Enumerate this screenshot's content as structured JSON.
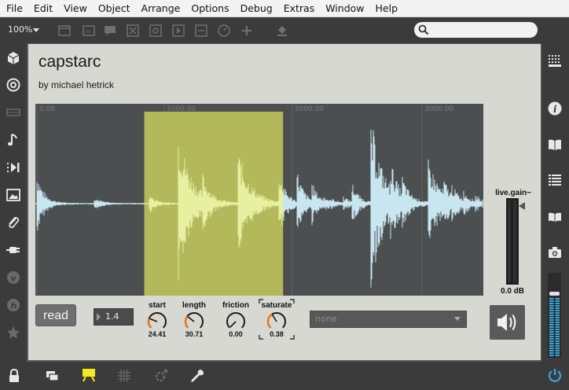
{
  "menubar": {
    "items": [
      "File",
      "Edit",
      "View",
      "Object",
      "Arrange",
      "Options",
      "Debug",
      "Extras",
      "Window",
      "Help"
    ]
  },
  "toolbar": {
    "zoom": "100%",
    "icons": [
      "presentation-icon",
      "comment-box-icon",
      "speech-bubble-icon",
      "close-box-icon",
      "object-icon",
      "play-box-icon",
      "minus-box-icon",
      "gauge-icon",
      "add-icon",
      "paint-bucket-icon"
    ],
    "search_placeholder": ""
  },
  "left_sidebar": {
    "icons": [
      "cube-icon",
      "target-icon",
      "slider-icon",
      "music-note-icon",
      "media-icon",
      "image-icon",
      "paperclip-icon",
      "plug-icon",
      "v-badge-icon",
      "h-badge-icon",
      "star-icon"
    ]
  },
  "right_sidebar": {
    "icons": [
      "grid-icon",
      "info-icon",
      "book-icon",
      "list-icon",
      "open-book-icon",
      "camera-icon"
    ]
  },
  "bottom_bar": {
    "icons": [
      "lock-icon",
      "windows-icon",
      "presentation-toggle-icon",
      "grid-toggle-icon",
      "gear-plus-icon",
      "wrench-icon",
      "power-icon"
    ]
  },
  "device": {
    "title": "capstarc",
    "author": "by michael hetrick",
    "read_label": "read",
    "number_box": "1.4",
    "knobs": [
      {
        "label": "start",
        "value": "24.41",
        "level": 0.2441
      },
      {
        "label": "length",
        "value": "30.71",
        "level": 0.3071
      },
      {
        "label": "friction",
        "value": "0.00",
        "level": 0.0
      },
      {
        "label": "saturate",
        "value": "0.38",
        "level": 0.38
      }
    ],
    "dropdown_value": "none",
    "gain_label": "live.gain~",
    "gain_value": "0.0 dB",
    "waveform": {
      "ruler_labels": [
        "0.00",
        "1000.00",
        "2000.00",
        "3000.00"
      ],
      "selection_start_fraction": 0.243,
      "selection_end_fraction": 0.553,
      "colors": {
        "background": "#4c4f4f",
        "wave": "#c8e6f0",
        "selection": "#b3b85a",
        "selected_wave": "#e6f0a0"
      }
    }
  },
  "colors": {
    "accent_orange": "#e8781e",
    "power_blue": "#35a8e0",
    "presentation_yellow": "#f2ea1a"
  }
}
